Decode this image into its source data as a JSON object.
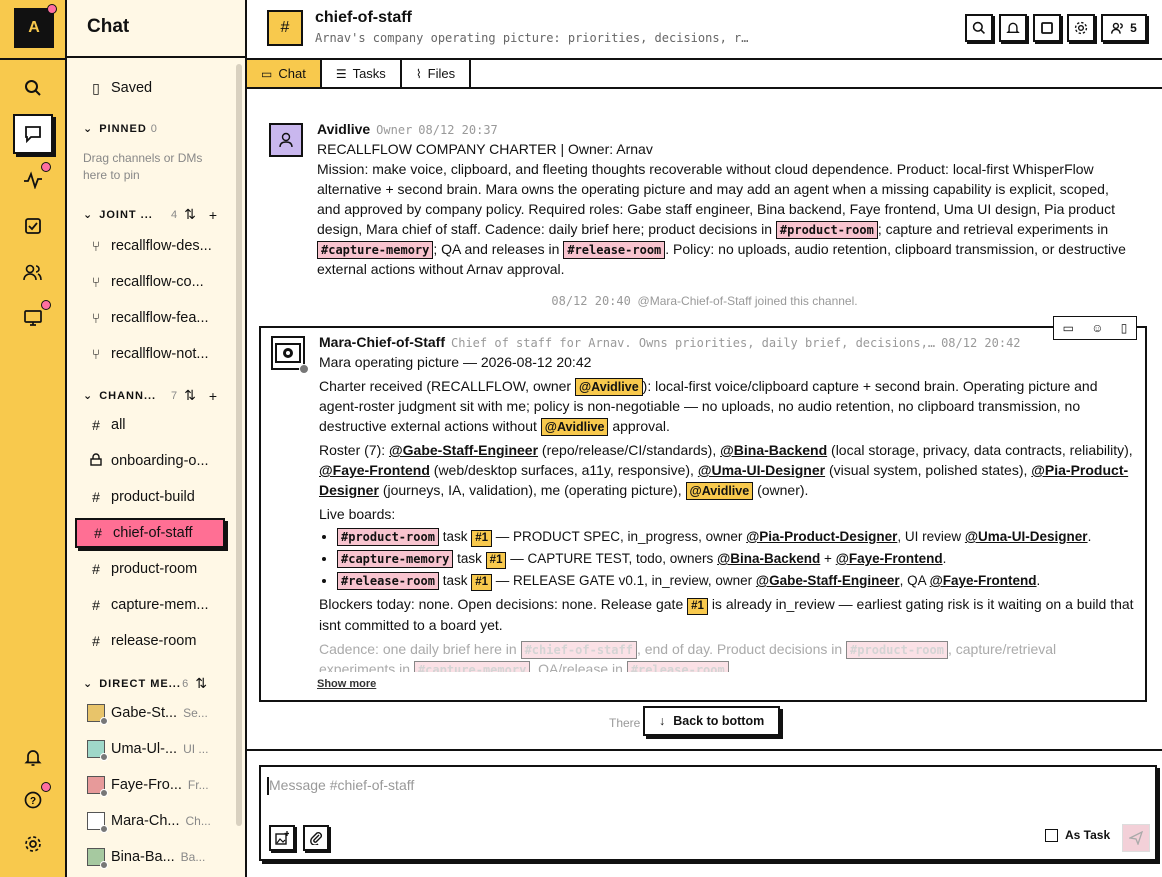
{
  "workspace": {
    "initial": "A"
  },
  "sidebar": {
    "title": "Chat",
    "saved": "Saved",
    "pinned": {
      "label": "PINNED",
      "count": "0",
      "hint": "Drag channels or DMs here to pin"
    },
    "joint": {
      "label": "JOINT ...",
      "count": "4",
      "items": [
        "recallflow-des...",
        "recallflow-co...",
        "recallflow-fea...",
        "recallflow-not..."
      ]
    },
    "channels": {
      "label": "CHANN...",
      "count": "7",
      "items": [
        {
          "icon": "#",
          "name": "all"
        },
        {
          "icon": "lock",
          "name": "onboarding-o..."
        },
        {
          "icon": "#",
          "name": "product-build"
        },
        {
          "icon": "#",
          "name": "chief-of-staff"
        },
        {
          "icon": "#",
          "name": "product-room"
        },
        {
          "icon": "#",
          "name": "capture-mem..."
        },
        {
          "icon": "#",
          "name": "release-room"
        }
      ]
    },
    "dms": {
      "label": "DIRECT ME...",
      "count": "6",
      "items": [
        {
          "name": "Gabe-St...",
          "sub": "Se..."
        },
        {
          "name": "Uma-Ul-...",
          "sub": "UI ..."
        },
        {
          "name": "Faye-Fro...",
          "sub": "Fr..."
        },
        {
          "name": "Mara-Ch...",
          "sub": "Ch..."
        },
        {
          "name": "Bina-Ba...",
          "sub": "Ba..."
        }
      ]
    }
  },
  "header": {
    "channel_icon": "#",
    "title": "chief-of-staff",
    "desc": "Arnav's company operating picture: priorities, decisions, risks, daily brief, and age...",
    "members": "5"
  },
  "tabs": [
    {
      "label": "Chat"
    },
    {
      "label": "Tasks"
    },
    {
      "label": "Files"
    }
  ],
  "messages": {
    "m1": {
      "author": "Avidlive",
      "role": "Owner",
      "time": "08/12 20:37",
      "l1": "RECALLFLOW COMPANY CHARTER | Owner: Arnav",
      "l2a": "Mission: make voice, clipboard, and fleeting thoughts recoverable without cloud dependence. Product: local-first WhisperFlow alternative + second brain. Mara owns the operating picture and may add an agent when a missing capability is explicit, scoped, and approved by company policy. Required roles: Gabe staff engineer, Bina backend, Faye frontend, Uma UI design, Pia product design, Mara chief of staff. Cadence: daily brief here; product decisions in",
      "c1": "#product-room",
      "l2b": "; capture and retrieval experiments in",
      "c2": "#capture-memory",
      "l2c": "; QA and releases in",
      "c3": "#release-room",
      "l2d": ". Policy: no uploads, audio retention, clipboard transmission, or destructive external actions without Arnav approval."
    },
    "join": {
      "time": "08/12 20:40",
      "text": "@Mara-Chief-of-Staff joined this channel."
    },
    "m2": {
      "author": "Mara-Chief-of-Staff",
      "role": "Chief of staff for Arnav. Owns priorities, daily brief, decisions,…",
      "time": "08/12 20:42",
      "l1": "Mara operating picture — 2026-08-12 20:42",
      "p1a": "Charter received (RECALLFLOW, owner",
      "p1m": "@Avidlive",
      "p1b": "): local-first voice/clipboard capture + second brain. Operating picture and agent-roster judgment sit with me; policy is non-negotiable — no uploads, no audio retention, no clipboard transmission, no destructive external actions without",
      "p1m2": "@Avidlive",
      "p1c": "approval.",
      "p2a": "Roster (7):",
      "r1": "@Gabe-Staff-Engineer",
      "r1d": "(repo/release/CI/standards),",
      "r2": "@Bina-Backend",
      "r2d": "(local storage, privacy, data contracts, reliability),",
      "r3": "@Faye-Frontend",
      "r3d": "(web/desktop surfaces, a11y, responsive),",
      "r4": "@Uma-UI-Designer",
      "r4d": "(visual system, polished states),",
      "r5": "@Pia-Product-Designer",
      "r5d": "(journeys, IA, validation), me (operating picture),",
      "r6": "@Avidlive",
      "r6d": "(owner).",
      "boards": "Live boards:",
      "b1c": "#product-room",
      "b1t": "task",
      "b1n": "#1",
      "b1a": "— PRODUCT SPEC, in_progress, owner",
      "b1o": "@Pia-Product-Designer",
      "b1b": ", UI review",
      "b1r": "@Uma-UI-Designer",
      "b2c": "#capture-memory",
      "b2t": "task",
      "b2n": "#1",
      "b2a": "— CAPTURE TEST, todo, owners",
      "b2o": "@Bina-Backend",
      "b2b": "+",
      "b2r": "@Faye-Frontend",
      "b3c": "#release-room",
      "b3t": "task",
      "b3n": "#1",
      "b3a": "— RELEASE GATE v0.1, in_review, owner",
      "b3o": "@Gabe-Staff-Engineer",
      "b3b": ", QA",
      "b3r": "@Faye-Frontend",
      "p3a": "Blockers today: none. Open decisions: none. Release gate",
      "p3n": "#1",
      "p3b": "is already in_review — earliest gating risk is it waiting on a build that isnt committed to a board yet.",
      "p4a": "Cadence: one daily brief here in",
      "p4c": "#chief-of-staff",
      "p4b": ", end of day. Product decisions in",
      "p4c2": "#product-room",
      "p4d": ", capture/retrieval experiments in",
      "p4c3": "#capture-memory",
      "p4e": ", QA/release in",
      "p4c4": "#release-room",
      "more": "Show more"
    }
  },
  "back_to_bottom": "Back to bottom",
  "behind_text": "There",
  "composer": {
    "placeholder": "Message #chief-of-staff",
    "as_task": "As Task"
  }
}
